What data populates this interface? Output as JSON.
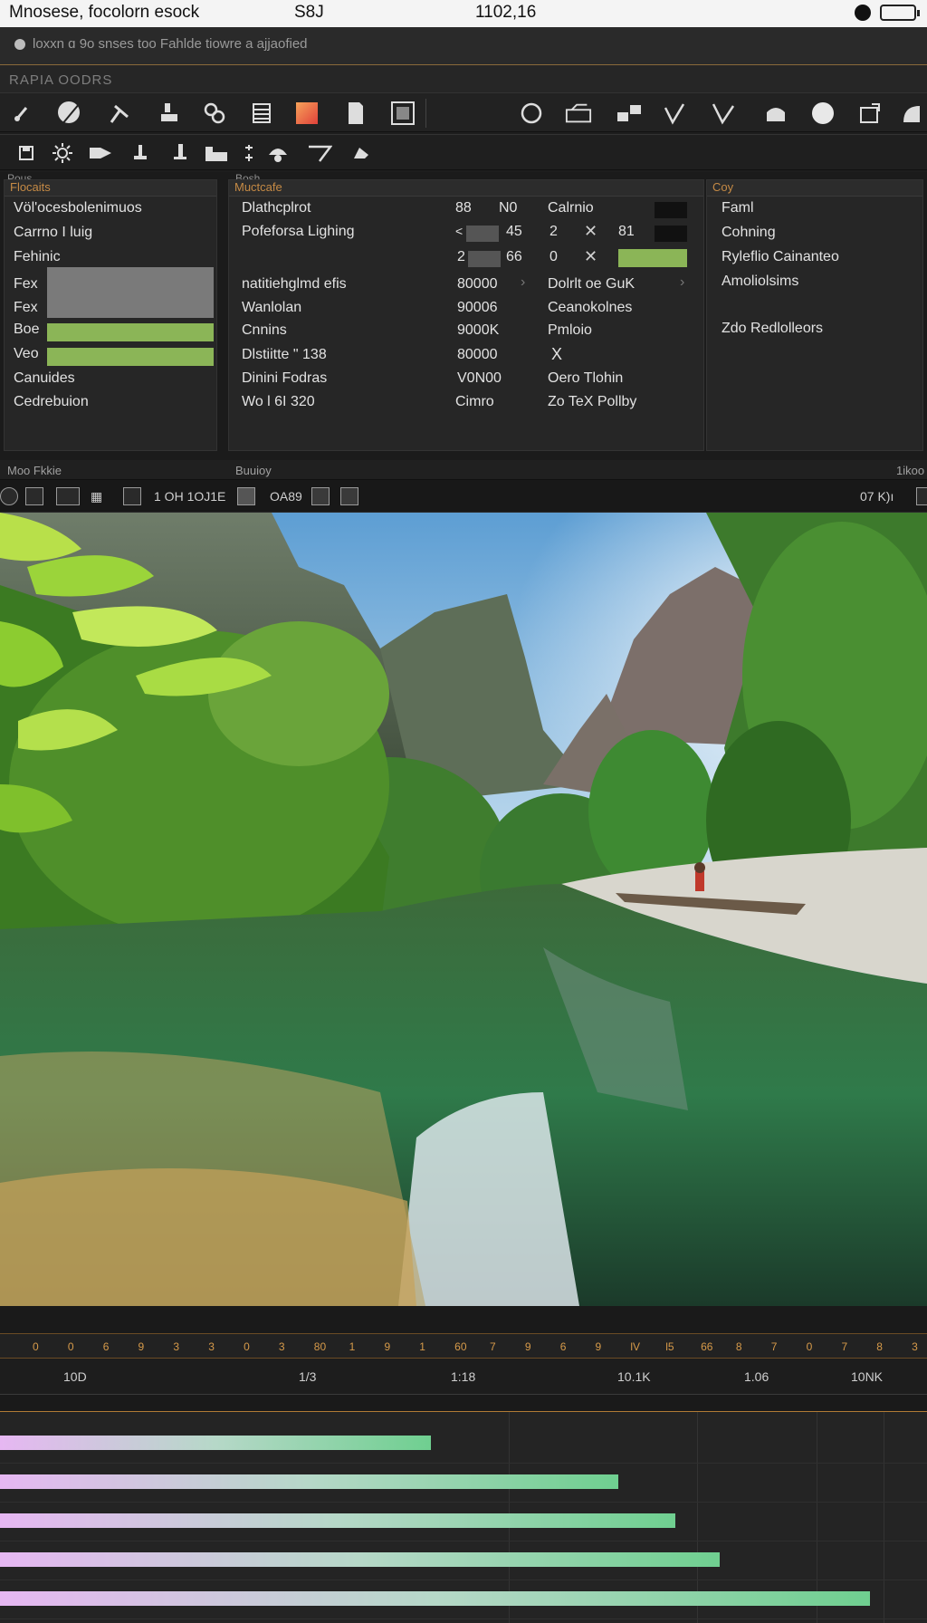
{
  "status": {
    "left": "Mnosese, focolorn esock",
    "mid1": "S8J",
    "mid2": "1102,16"
  },
  "notice": {
    "text": "loxxn ɑ  9o snses too Fahlde tiowre a ajjaofied"
  },
  "section": {
    "title": "RAPIA OODRS"
  },
  "toolbar_icons": [
    "brush-icon",
    "eraser-icon",
    "pick-icon",
    "stack-icon",
    "link-icon",
    "layers-icon",
    "color-swatch-icon",
    "page-icon",
    "texture-icon",
    "circle-icon",
    "camera-icon",
    "blocks-icon",
    "check-icon",
    "ruler-icon",
    "pot-icon",
    "sphere-icon",
    "export-icon",
    "shell-icon"
  ],
  "toolbar2_icons": [
    "save-icon",
    "sun-icon",
    "play-icon",
    "puppet-icon",
    "pin-icon",
    "folder-icon",
    "sparkle-icon",
    "lamp-icon",
    "cursor-icon",
    "hand-icon"
  ],
  "props": {
    "top_left_caption": "Pous",
    "top_mid_caption": "Bosh",
    "left_header": "Flocaits",
    "left_items": [
      "Völ'ocesbolenimuos",
      "Carrno I luig",
      "Fehinic",
      "Fex",
      "Fex",
      "Boe",
      "Veo",
      "Canuides",
      "Cedrebuion"
    ],
    "mid_header": "Muctcafe",
    "mid_rows": [
      {
        "label": "Dlathcplrot",
        "v1": "88",
        "v2": "N0",
        "v3": "Calrnio"
      },
      {
        "label": "Pofeforsa Lighing",
        "v1": "45",
        "v2": "2",
        "v3": "81"
      },
      {
        "label": "",
        "v1": "2",
        "v2": "66",
        "v3": "0"
      },
      {
        "label": "natitiehglmd efis",
        "v1": "80000",
        "v2": "",
        "v3": "Dolrlt oe GuK"
      },
      {
        "label": "Wanlolan",
        "v1": "90006",
        "v2": "",
        "v3": "Ceanokolnes"
      },
      {
        "label": "Cnnins",
        "v1": "9000K",
        "v2": "",
        "v3": "Pmloio"
      },
      {
        "label": "Dlstiitte \" 138",
        "v1": "80000",
        "v2": "",
        "v3": "X"
      },
      {
        "label": "Dinini Fodras",
        "v1": "V0N00",
        "v2": "",
        "v3": "Oero Tlohin"
      },
      {
        "label": "Wo l 6I 320",
        "v1": "Cimro",
        "v2": "",
        "v3": "Zo TeX Pollby"
      }
    ],
    "right_header": "Coy",
    "right_items": [
      "Faml",
      "Cohning",
      "Ryleflio Cainanteo",
      "Amoliolsims",
      "",
      "Zdo Redlolleors"
    ]
  },
  "footer": {
    "left": "Moo  Fkkie",
    "mid": "Buuioy",
    "right": "1ikoo"
  },
  "viewport_toolbar": {
    "zoom_text": "1 OH  1OJ1E",
    "mode_text": "OA89",
    "right_text": "07  K)ı"
  },
  "timeline": {
    "ruler_ticks": [
      "0",
      "0",
      "6",
      "9",
      "3",
      "3",
      "0",
      "3",
      "80",
      "1",
      "9",
      "1",
      "60",
      "7",
      "9",
      "6",
      "9",
      "lV",
      "l5",
      "66",
      "8",
      "7",
      "0",
      "7",
      "8",
      "3"
    ],
    "ruler2_labels": [
      "10D",
      "1/3",
      "1:18",
      "10.1K",
      "1.06",
      "10NK"
    ],
    "bars": [
      0.465,
      0.667,
      0.729,
      0.776,
      0.938
    ]
  },
  "colors": {
    "accent": "#c58a45",
    "green_swatch": "#8bb557",
    "bar_end": "#6fcf90",
    "bar_start": "#e6b7f2"
  }
}
